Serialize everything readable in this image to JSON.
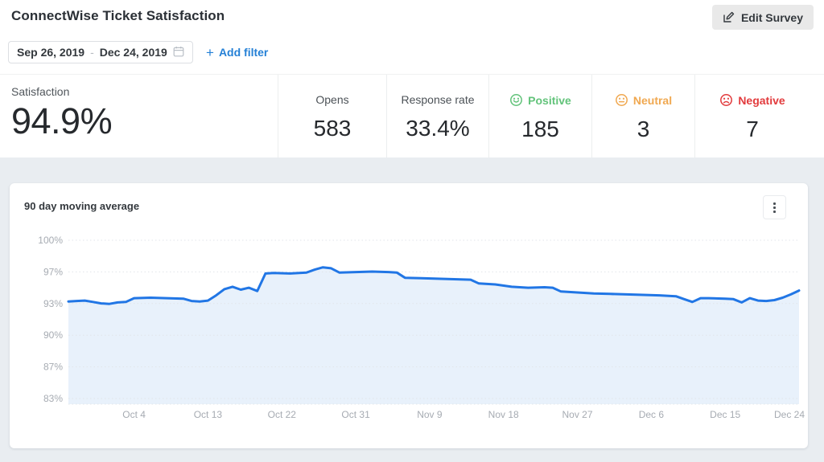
{
  "header": {
    "title": "ConnectWise Ticket Satisfaction",
    "edit_button_label": "Edit Survey"
  },
  "filters": {
    "date_start": "Sep 26, 2019",
    "date_separator": "-",
    "date_end": "Dec 24, 2019",
    "add_filter_label": "Add filter",
    "plus_glyph": "+"
  },
  "stats": {
    "satisfaction": {
      "label": "Satisfaction",
      "value": "94.9%"
    },
    "metrics": [
      {
        "id": "opens",
        "label": "Opens",
        "value": "583",
        "face": null,
        "color": null
      },
      {
        "id": "response-rate",
        "label": "Response rate",
        "value": "33.4%",
        "face": null,
        "color": null
      },
      {
        "id": "positive",
        "label": "Positive",
        "value": "185",
        "face": "smile",
        "color": "#62c37a"
      },
      {
        "id": "neutral",
        "label": "Neutral",
        "value": "3",
        "face": "meh",
        "color": "#f0a850"
      },
      {
        "id": "negative",
        "label": "Negative",
        "value": "7",
        "face": "frown",
        "color": "#e23b3d"
      }
    ]
  },
  "chart": {
    "title": "90 day moving average"
  },
  "chart_data": {
    "type": "line",
    "title": "90 day moving average",
    "x_start_label": "Sep 26, 2019",
    "x_end_label": "Dec 24, 2019",
    "xlim_days": [
      0,
      89
    ],
    "ylim": [
      83.333,
      100
    ],
    "grid": "dotted-horizontal",
    "legend": "none",
    "y_ticks": [
      {
        "value": 100,
        "label": "100%"
      },
      {
        "value": 96.667,
        "label": "97%"
      },
      {
        "value": 93.333,
        "label": "93%"
      },
      {
        "value": 90,
        "label": "90%"
      },
      {
        "value": 86.667,
        "label": "87%"
      },
      {
        "value": 83.333,
        "label": "83%"
      }
    ],
    "x_ticks": [
      {
        "day": 8,
        "label": "Oct 4"
      },
      {
        "day": 17,
        "label": "Oct 13"
      },
      {
        "day": 26,
        "label": "Oct 22"
      },
      {
        "day": 35,
        "label": "Oct 31"
      },
      {
        "day": 44,
        "label": "Nov 9"
      },
      {
        "day": 53,
        "label": "Nov 18"
      },
      {
        "day": 62,
        "label": "Nov 27"
      },
      {
        "day": 71,
        "label": "Dec 6"
      },
      {
        "day": 80,
        "label": "Dec 15"
      },
      {
        "day": 89,
        "label": "Dec 24"
      }
    ],
    "series": [
      {
        "name": "90 day moving average (%)",
        "line_color": "#2176e5",
        "fill_color": "#e8f1fb",
        "points": [
          [
            0,
            93.55
          ],
          [
            1,
            93.6
          ],
          [
            2,
            93.65
          ],
          [
            3,
            93.5
          ],
          [
            4,
            93.35
          ],
          [
            5,
            93.3
          ],
          [
            6,
            93.45
          ],
          [
            7,
            93.5
          ],
          [
            8,
            93.9
          ],
          [
            10,
            93.95
          ],
          [
            12,
            93.9
          ],
          [
            14,
            93.85
          ],
          [
            15,
            93.6
          ],
          [
            16,
            93.55
          ],
          [
            17,
            93.65
          ],
          [
            18,
            94.2
          ],
          [
            19,
            94.85
          ],
          [
            20,
            95.1
          ],
          [
            21,
            94.8
          ],
          [
            22,
            95.0
          ],
          [
            23,
            94.65
          ],
          [
            24,
            96.5
          ],
          [
            25,
            96.55
          ],
          [
            27,
            96.5
          ],
          [
            29,
            96.6
          ],
          [
            30,
            96.9
          ],
          [
            31,
            97.15
          ],
          [
            32,
            97.05
          ],
          [
            33,
            96.6
          ],
          [
            35,
            96.65
          ],
          [
            37,
            96.7
          ],
          [
            39,
            96.65
          ],
          [
            40,
            96.6
          ],
          [
            41,
            96.05
          ],
          [
            43,
            96.0
          ],
          [
            45,
            95.95
          ],
          [
            47,
            95.9
          ],
          [
            49,
            95.85
          ],
          [
            50,
            95.45
          ],
          [
            52,
            95.35
          ],
          [
            54,
            95.1
          ],
          [
            56,
            95.0
          ],
          [
            58,
            95.05
          ],
          [
            59,
            95.0
          ],
          [
            60,
            94.6
          ],
          [
            62,
            94.5
          ],
          [
            64,
            94.4
          ],
          [
            66,
            94.35
          ],
          [
            68,
            94.3
          ],
          [
            70,
            94.25
          ],
          [
            72,
            94.2
          ],
          [
            74,
            94.1
          ],
          [
            75,
            93.8
          ],
          [
            76,
            93.5
          ],
          [
            77,
            93.9
          ],
          [
            78,
            93.9
          ],
          [
            80,
            93.85
          ],
          [
            81,
            93.8
          ],
          [
            82,
            93.45
          ],
          [
            83,
            93.9
          ],
          [
            84,
            93.65
          ],
          [
            85,
            93.6
          ],
          [
            86,
            93.7
          ],
          [
            87,
            93.95
          ],
          [
            88,
            94.3
          ],
          [
            89,
            94.7
          ]
        ]
      }
    ]
  },
  "colors": {
    "accent_blue": "#2480d6",
    "line_blue": "#2176e5",
    "area_fill": "#e8f1fb",
    "positive_green": "#62c37a",
    "neutral_orange": "#f0a850",
    "negative_red": "#e23b3d",
    "panel_gray": "#e9edf1"
  }
}
